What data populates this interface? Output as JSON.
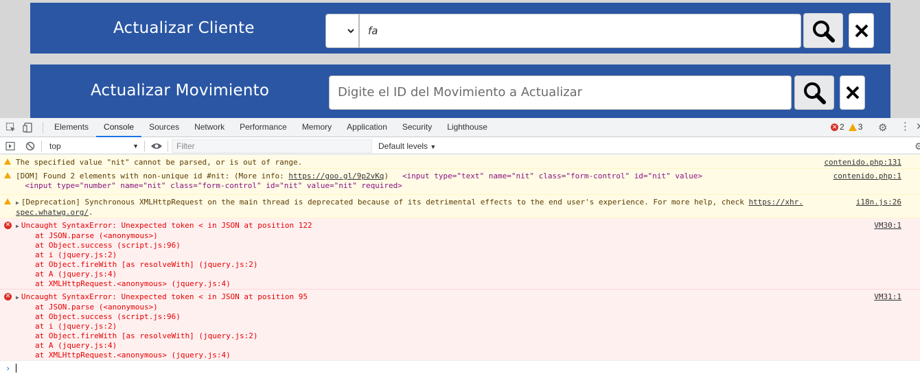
{
  "page": {
    "banner_1": {
      "title": "Actualizar Cliente",
      "search_value": "fa"
    },
    "banner_2": {
      "title": "Actualizar Movimiento",
      "search_placeholder": "Digite el ID del Movimiento a Actualizar"
    }
  },
  "devtools": {
    "tabs": [
      "Elements",
      "Console",
      "Sources",
      "Network",
      "Performance",
      "Memory",
      "Application",
      "Security",
      "Lighthouse"
    ],
    "active_tab": "Console",
    "error_count": "2",
    "warning_count": "3",
    "context": "top",
    "filter_placeholder": "Filter",
    "levels_label": "Default levels"
  },
  "console": {
    "msg1": {
      "text": "The specified value \"nit\" cannot be parsed, or is out of range.",
      "source": "contenido.php:131"
    },
    "msg2": {
      "prefix": "[DOM] Found 2 elements with non-unique id #nit: (More info: ",
      "link": "https://goo.gl/9p2vKq",
      "suffix": ")",
      "el1": "<input type=\"text\" name=\"nit\" class=\"form-control\" id=\"nit\" value>",
      "el2": "<input type=\"number\" name=\"nit\" class=\"form-control\" id=\"nit\" value=\"nit\" required>",
      "source": "contenido.php:1"
    },
    "msg3": {
      "text": "[Deprecation] Synchronous XMLHttpRequest on the main thread is deprecated because of its detrimental effects to the end user's experience. For more help, check ",
      "link1": "https://xhr.",
      "link2": "spec.whatwg.org/",
      "tail": ".",
      "source": "i18n.js:26"
    },
    "err1": {
      "text": "Uncaught SyntaxError: Unexpected token < in JSON at position 122",
      "source": "VM30:1",
      "frames": [
        "at JSON.parse (<anonymous>)",
        "at Object.success (script.js:96)",
        "at i (jquery.js:2)",
        "at Object.fireWith [as resolveWith] (jquery.js:2)",
        "at A (jquery.js:4)",
        "at XMLHttpRequest.<anonymous> (jquery.js:4)"
      ]
    },
    "err2": {
      "text": "Uncaught SyntaxError: Unexpected token < in JSON at position 95",
      "source": "VM31:1",
      "frames": [
        "at JSON.parse (<anonymous>)",
        "at Object.success (script.js:96)",
        "at i (jquery.js:2)",
        "at Object.fireWith [as resolveWith] (jquery.js:2)",
        "at A (jquery.js:4)",
        "at XMLHttpRequest.<anonymous> (jquery.js:4)"
      ]
    }
  },
  "colors": {
    "banner": "#2a56a4",
    "tab_active": "#1a73e8",
    "error": "#d93025",
    "warning": "#f2a600"
  }
}
